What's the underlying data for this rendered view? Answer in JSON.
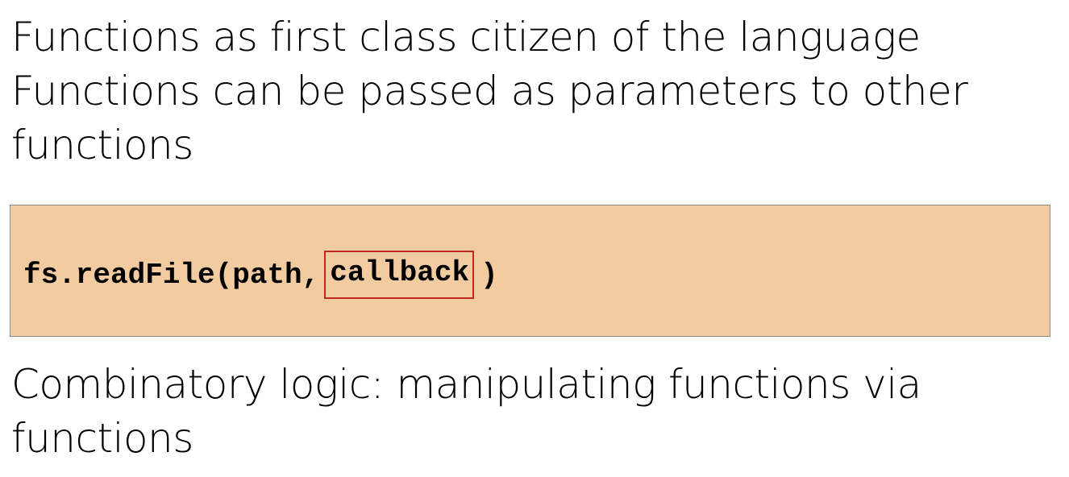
{
  "slide": {
    "line1": "Functions as first class citizen of the language",
    "line2": "Functions can be passed as parameters to other",
    "line2b": "functions",
    "line3": "Combinatory logic: manipulating functions via",
    "line3b": "functions"
  },
  "code": {
    "prefix": "fs.readFile(path,",
    "highlighted": "callback",
    "suffix": ")",
    "background_color": "#f2cba1",
    "highlight_color": "#c0281e"
  }
}
